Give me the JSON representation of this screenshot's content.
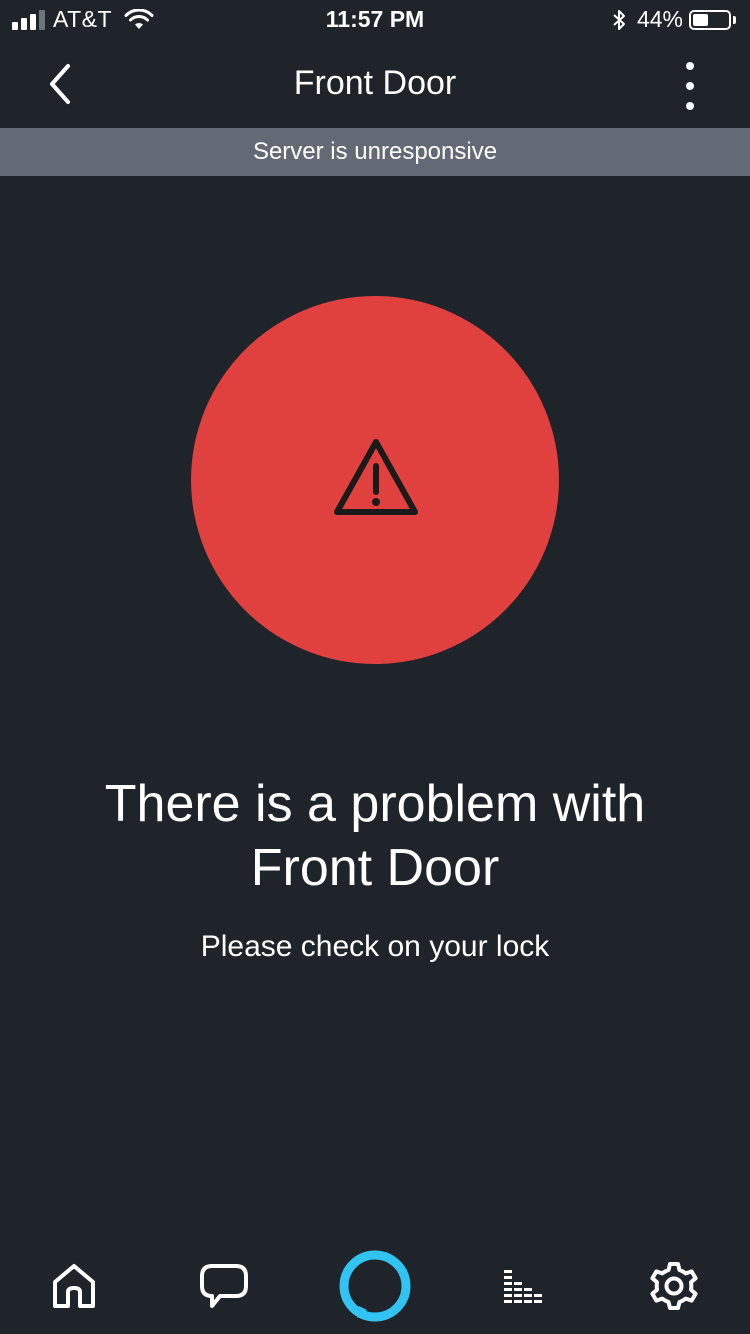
{
  "status_bar": {
    "carrier": "AT&T",
    "time": "11:57 PM",
    "battery_percent": "44%",
    "battery_level": 0.44,
    "signal_bars_filled": 3,
    "signal_bars_total": 4
  },
  "header": {
    "title": "Front Door"
  },
  "banner": {
    "text": "Server is unresponsive"
  },
  "alert": {
    "title_line1": "There is a problem with",
    "title_line2": "Front Door",
    "subtitle": "Please check on your lock"
  },
  "tab_bar": {
    "tabs": [
      {
        "icon": "home-icon"
      },
      {
        "icon": "chat-icon"
      },
      {
        "icon": "alexa-icon"
      },
      {
        "icon": "play-icon"
      },
      {
        "icon": "gear-icon"
      }
    ]
  },
  "colors": {
    "background": "#1f232a",
    "banner": "#636a75",
    "alert_circle": "#e0403e",
    "alexa_blue": "#31c4f3"
  }
}
